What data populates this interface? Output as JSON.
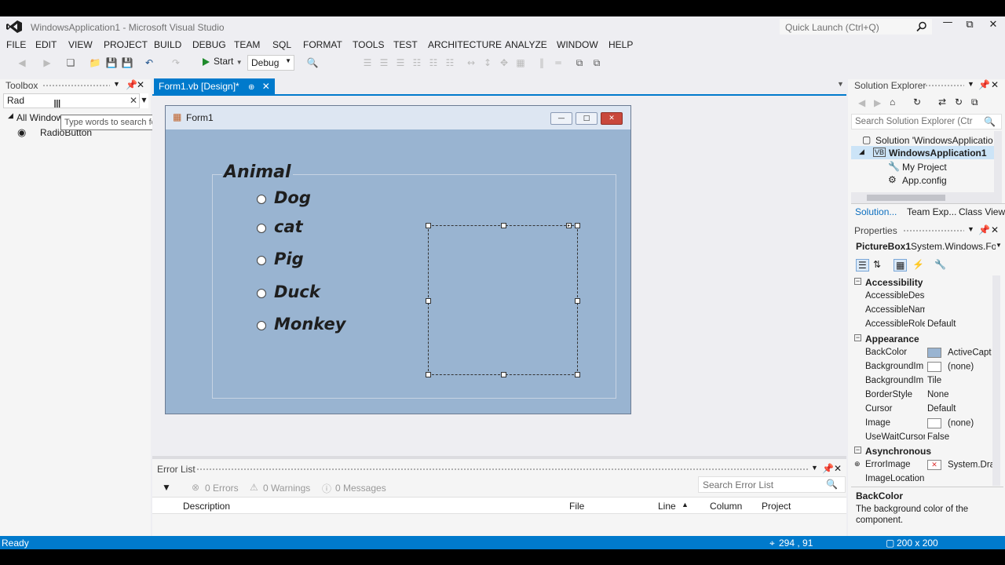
{
  "app": {
    "title": "WindowsApplication1 - Microsoft Visual Studio",
    "quick_launch_placeholder": "Quick Launch (Ctrl+Q)"
  },
  "menu": [
    "FILE",
    "EDIT",
    "VIEW",
    "PROJECT",
    "BUILD",
    "DEBUG",
    "TEAM",
    "SQL",
    "FORMAT",
    "TOOLS",
    "TEST",
    "ARCHITECTURE",
    "ANALYZE",
    "WINDOW",
    "HELP"
  ],
  "toolbar": {
    "start_label": "Start",
    "config_value": "Debug"
  },
  "toolbox": {
    "title": "Toolbox",
    "search_value": "Rad",
    "tooltip": "Type words to search for",
    "group": "All Window",
    "item": "RadioButton"
  },
  "document_tab": {
    "label": "Form1.vb [Design]*"
  },
  "form": {
    "caption": "Form1",
    "groupbox_label": "Animal",
    "radios": [
      "Dog",
      "cat",
      "Pig",
      "Duck",
      "Monkey"
    ]
  },
  "error_list": {
    "title": "Error List",
    "errors": "0 Errors",
    "warnings": "0 Warnings",
    "messages": "0 Messages",
    "search_placeholder": "Search Error List",
    "columns": [
      "Description",
      "File",
      "Line",
      "Column",
      "Project"
    ]
  },
  "status": {
    "text": "Ready",
    "position": "294 , 91",
    "size": "200 x 200"
  },
  "solution_explorer": {
    "title": "Solution Explorer",
    "search_placeholder": "Search Solution Explorer (Ctrl+;)",
    "items": [
      "Solution 'WindowsApplicatio",
      "WindowsApplication1",
      "My Project",
      "App.config"
    ],
    "tabs": [
      "Solution...",
      "Team Exp...",
      "Class View"
    ]
  },
  "properties": {
    "title": "Properties",
    "object_name": "PictureBox1",
    "object_type": "System.Windows.For",
    "categories": {
      "accessibility": "Accessibility",
      "appearance": "Appearance",
      "asynchronous": "Asynchronous"
    },
    "accessibility_rows": [
      {
        "name": "AccessibleDesc",
        "value": ""
      },
      {
        "name": "AccessibleNam",
        "value": ""
      },
      {
        "name": "AccessibleRole",
        "value": "Default"
      }
    ],
    "appearance_rows": [
      {
        "name": "BackColor",
        "value": "ActiveCapt"
      },
      {
        "name": "BackgroundIm",
        "value": "(none)"
      },
      {
        "name": "BackgroundIm",
        "value": "Tile"
      },
      {
        "name": "BorderStyle",
        "value": "None"
      },
      {
        "name": "Cursor",
        "value": "Default"
      },
      {
        "name": "Image",
        "value": "(none)"
      },
      {
        "name": "UseWaitCursor",
        "value": "False"
      }
    ],
    "async_rows": [
      {
        "name": "ErrorImage",
        "value": "System.Dra"
      },
      {
        "name": "ImageLocation",
        "value": ""
      }
    ],
    "description_title": "BackColor",
    "description_text": "The background color of the component."
  },
  "colors": {
    "accent": "#007acc",
    "form_back": "#99b4d1",
    "chrome": "#eeeef2"
  }
}
